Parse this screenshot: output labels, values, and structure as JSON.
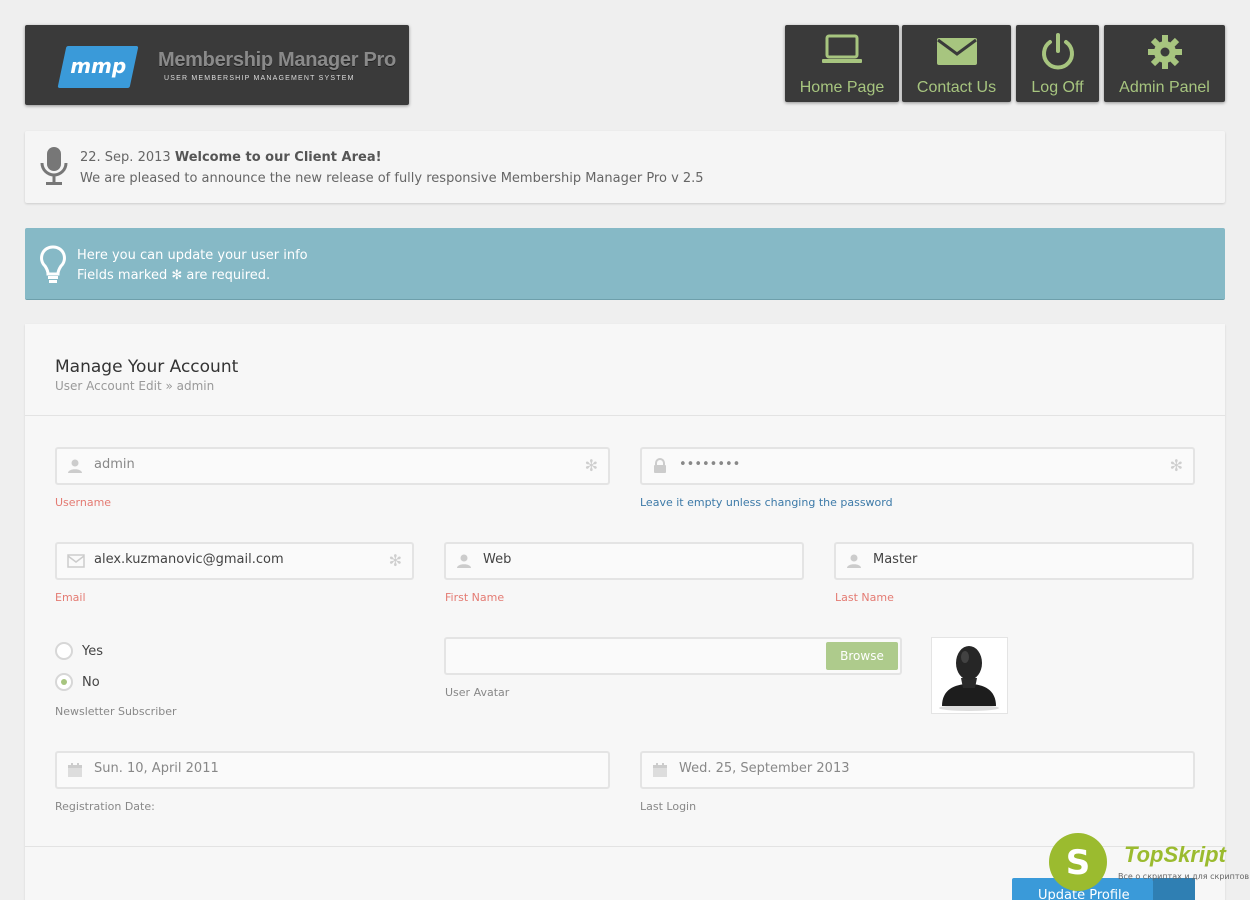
{
  "logo": {
    "badge": "mmp",
    "title": "Membership Manager Pro",
    "subtitle": "USER MEMBERSHIP MANAGEMENT SYSTEM"
  },
  "nav": [
    {
      "label": "Home Page",
      "icon": "laptop-icon"
    },
    {
      "label": "Contact Us",
      "icon": "envelope-icon"
    },
    {
      "label": "Log Off",
      "icon": "power-icon"
    },
    {
      "label": "Admin Panel",
      "icon": "gear-icon"
    }
  ],
  "announcement": {
    "date": "22. Sep. 2013",
    "title": "Welcome to our Client Area!",
    "message": "We are pleased to announce the new release of fully responsive Membership Manager Pro v 2.5"
  },
  "info": {
    "line1": "Here you can update your user info",
    "line2_pre": "Fields marked",
    "line2_post": "are required."
  },
  "panel": {
    "title": "Manage Your Account",
    "breadcrumb": "User Account Edit » admin"
  },
  "form": {
    "username": {
      "value": "admin",
      "label": "Username"
    },
    "password": {
      "value": "••••••••",
      "label": "Leave it empty unless changing the password"
    },
    "email": {
      "value": "alex.kuzmanovic@gmail.com",
      "label": "Email"
    },
    "first_name": {
      "value": "Web",
      "label": "First Name"
    },
    "last_name": {
      "value": "Master",
      "label": "Last Name"
    },
    "newsletter": {
      "options": [
        "Yes",
        "No"
      ],
      "selected": "No",
      "label": "Newsletter Subscriber"
    },
    "avatar": {
      "button": "Browse",
      "label": "User Avatar"
    },
    "registration": {
      "value": "Sun. 10, April 2011",
      "label": "Registration Date:"
    },
    "last_login": {
      "value": "Wed. 25, September 2013",
      "label": "Last Login"
    },
    "submit": "Update Profile"
  },
  "watermark": {
    "name": "TopSkript",
    "tagline": "Все о скриптах и для скриптов..."
  },
  "colors": {
    "accent": "#a7c57f",
    "info": "#86b9c6",
    "dark": "#3a3a3a",
    "primary": "#3a9ad9"
  }
}
